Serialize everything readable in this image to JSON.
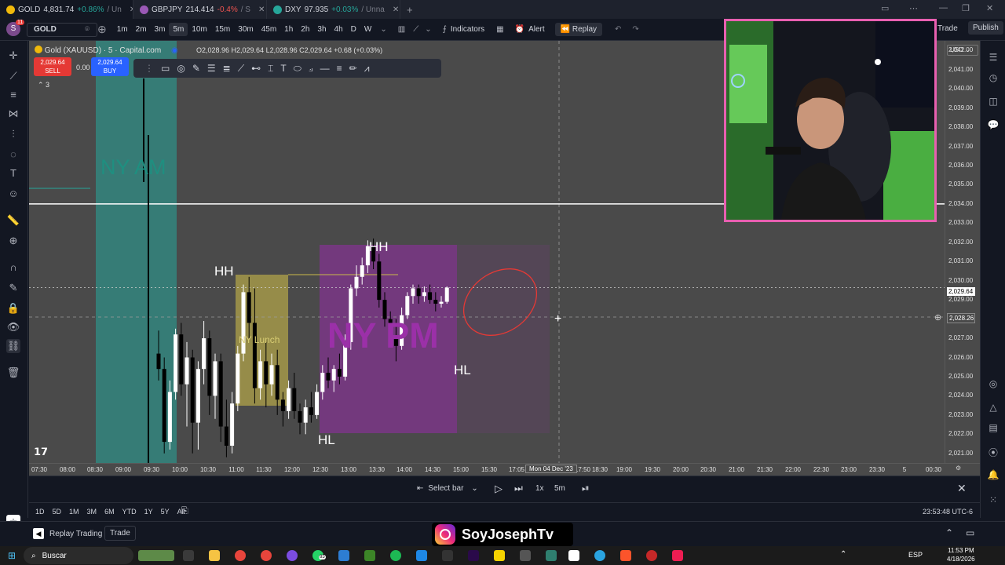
{
  "browser_tabs": [
    {
      "label": "GOLD",
      "price": "4,831.74",
      "change": "+0.86%",
      "suffix": "/ Un",
      "dir": "pos"
    },
    {
      "label": "GBPJPY",
      "price": "214.414",
      "change": "-0.4%",
      "suffix": "/ S",
      "dir": "neg"
    },
    {
      "label": "DXY",
      "price": "97.935",
      "change": "+0.03%",
      "suffix": "/ Unna",
      "dir": "pos"
    }
  ],
  "toolbar": {
    "avatar_badge": "11",
    "symbol": "GOLD",
    "timeframes": [
      "1m",
      "2m",
      "3m",
      "5m",
      "10m",
      "15m",
      "30m",
      "45m",
      "1h",
      "2h",
      "3h",
      "4h",
      "D",
      "W"
    ],
    "selected_timeframe": "5m",
    "indicators_label": "Indicators",
    "alert_label": "Alert",
    "replay_label": "Replay",
    "trade_label": "Trade",
    "publish_label": "Publish"
  },
  "legend": {
    "title": "Gold (XAUUSD) · 5 · Capital.com",
    "ohlc": "O2,028.96  H2,029.64  L2,028.96  C2,029.64  +0.68 (+0.03%)",
    "sell_price": "2,029.64",
    "sell_label": "SELL",
    "spread": "0.00",
    "buy_price": "2,029.64",
    "buy_label": "BUY",
    "collapsed_count": "3"
  },
  "chart_overlay_labels": {
    "ny_am": "NY AM",
    "ny_lunch": "NY Lunch",
    "ny_pm": "NY PM",
    "hh_left": "HH",
    "hh_right": "HH",
    "hl_bottom": "HL",
    "hl_right": "HL"
  },
  "price_axis": {
    "currency": "USD",
    "ticks": [
      "2,042.00",
      "2,041.00",
      "2,040.00",
      "2,039.00",
      "2,038.00",
      "2,037.00",
      "2,036.00",
      "2,035.00",
      "2,034.00",
      "2,033.00",
      "2,032.00",
      "2,031.00",
      "2,030.00",
      "2,029.00",
      "2,028.00",
      "2,027.00",
      "2,026.00",
      "2,025.00",
      "2,024.00",
      "2,023.00",
      "2,022.00",
      "2,021.00"
    ],
    "current_price": "2,029.64",
    "crosshair_price": "2,028.26"
  },
  "time_axis": {
    "ticks": [
      "07:30",
      "08:00",
      "08:30",
      "09:00",
      "09:30",
      "10:00",
      "10:30",
      "11:00",
      "11:30",
      "12:00",
      "12:30",
      "13:00",
      "13:30",
      "14:00",
      "14:30",
      "15:00",
      "15:30",
      "17:05",
      "17:50",
      "18:30",
      "19:00",
      "19:30",
      "20:00",
      "20:30",
      "21:00",
      "21:30",
      "22:00",
      "22:30",
      "23:00",
      "23:30",
      "5",
      "00:30"
    ],
    "cursor_date": "Mon 04 Dec '23"
  },
  "replay_bar": {
    "select_bar_label": "Select bar",
    "speed": "1x",
    "interval": "5m"
  },
  "range_bar": {
    "ranges": [
      "1D",
      "5D",
      "1M",
      "3M",
      "6M",
      "YTD",
      "1Y",
      "5Y",
      "All"
    ],
    "clock": "23:53:48 UTC-6"
  },
  "bottom_panel": {
    "replay_trading_label": "Replay Trading",
    "trade_label": "Trade",
    "instagram_handle": "SoyJosephTv"
  },
  "taskbar": {
    "search_label": "Buscar",
    "language": "ESP",
    "time": "11:53 PM",
    "date": "4/18/2026",
    "whatsapp_badge": "85"
  },
  "colors": {
    "ny_am_zone": "#26a69a",
    "ny_lunch_zone": "#c9b94a",
    "ny_pm_zone": "#9c27b0",
    "up_candle": "#ffffff",
    "down_candle": "#000000",
    "annotation_ellipse": "#e53935",
    "webcam_border": "#e85fb0"
  },
  "chart_data": {
    "type": "candlestick",
    "timeframe": "5m",
    "ylim": [
      2020.5,
      2042.5
    ],
    "key_level": 2034.0,
    "candles": [
      {
        "o": 2026.2,
        "h": 2027.4,
        "l": 2024.8,
        "c": 2025.4
      },
      {
        "o": 2025.4,
        "h": 2026.0,
        "l": 2021.0,
        "c": 2021.6
      },
      {
        "o": 2021.6,
        "h": 2024.8,
        "l": 2021.2,
        "c": 2024.2
      },
      {
        "o": 2024.2,
        "h": 2027.5,
        "l": 2023.8,
        "c": 2027.2
      },
      {
        "o": 2027.2,
        "h": 2027.8,
        "l": 2024.0,
        "c": 2024.6
      },
      {
        "o": 2024.6,
        "h": 2026.8,
        "l": 2022.4,
        "c": 2026.0
      },
      {
        "o": 2026.0,
        "h": 2026.4,
        "l": 2021.0,
        "c": 2022.6
      },
      {
        "o": 2022.6,
        "h": 2025.8,
        "l": 2021.2,
        "c": 2025.4
      },
      {
        "o": 2025.4,
        "h": 2027.9,
        "l": 2024.6,
        "c": 2027.0
      },
      {
        "o": 2027.0,
        "h": 2027.4,
        "l": 2023.0,
        "c": 2024.0
      },
      {
        "o": 2024.0,
        "h": 2026.2,
        "l": 2022.8,
        "c": 2025.8
      },
      {
        "o": 2025.8,
        "h": 2026.2,
        "l": 2021.6,
        "c": 2022.4
      },
      {
        "o": 2022.4,
        "h": 2023.8,
        "l": 2020.8,
        "c": 2021.4
      },
      {
        "o": 2021.4,
        "h": 2024.2,
        "l": 2021.0,
        "c": 2023.6
      },
      {
        "o": 2023.6,
        "h": 2026.6,
        "l": 2023.2,
        "c": 2026.2
      },
      {
        "o": 2026.2,
        "h": 2029.8,
        "l": 2025.8,
        "c": 2029.4
      },
      {
        "o": 2029.4,
        "h": 2030.2,
        "l": 2027.0,
        "c": 2027.8
      },
      {
        "o": 2027.8,
        "h": 2029.6,
        "l": 2023.6,
        "c": 2024.4
      },
      {
        "o": 2024.4,
        "h": 2026.4,
        "l": 2023.8,
        "c": 2025.8
      },
      {
        "o": 2025.8,
        "h": 2026.8,
        "l": 2023.4,
        "c": 2024.6
      },
      {
        "o": 2024.6,
        "h": 2026.2,
        "l": 2024.0,
        "c": 2025.6
      },
      {
        "o": 2025.6,
        "h": 2026.4,
        "l": 2023.0,
        "c": 2023.8
      },
      {
        "o": 2023.8,
        "h": 2024.2,
        "l": 2022.4,
        "c": 2023.2
      },
      {
        "o": 2023.2,
        "h": 2024.8,
        "l": 2022.8,
        "c": 2024.4
      },
      {
        "o": 2024.4,
        "h": 2025.2,
        "l": 2022.8,
        "c": 2023.2
      },
      {
        "o": 2023.2,
        "h": 2023.6,
        "l": 2022.0,
        "c": 2022.6
      },
      {
        "o": 2022.6,
        "h": 2023.8,
        "l": 2022.0,
        "c": 2023.4
      },
      {
        "o": 2023.4,
        "h": 2024.2,
        "l": 2022.6,
        "c": 2023.0
      },
      {
        "o": 2023.0,
        "h": 2024.6,
        "l": 2022.8,
        "c": 2024.2
      },
      {
        "o": 2024.2,
        "h": 2025.6,
        "l": 2023.8,
        "c": 2025.2
      },
      {
        "o": 2025.2,
        "h": 2026.0,
        "l": 2024.4,
        "c": 2024.8
      },
      {
        "o": 2024.8,
        "h": 2025.6,
        "l": 2024.2,
        "c": 2025.4
      },
      {
        "o": 2025.4,
        "h": 2026.2,
        "l": 2024.6,
        "c": 2025.0
      },
      {
        "o": 2025.0,
        "h": 2027.2,
        "l": 2024.8,
        "c": 2026.8
      },
      {
        "o": 2026.8,
        "h": 2029.8,
        "l": 2026.4,
        "c": 2029.6
      },
      {
        "o": 2029.6,
        "h": 2030.8,
        "l": 2029.2,
        "c": 2030.2
      },
      {
        "o": 2030.2,
        "h": 2031.2,
        "l": 2029.8,
        "c": 2030.8
      },
      {
        "o": 2030.8,
        "h": 2032.1,
        "l": 2030.4,
        "c": 2031.8
      },
      {
        "o": 2031.8,
        "h": 2032.2,
        "l": 2030.6,
        "c": 2031.0
      },
      {
        "o": 2031.0,
        "h": 2031.4,
        "l": 2028.6,
        "c": 2029.0
      },
      {
        "o": 2029.0,
        "h": 2029.4,
        "l": 2027.6,
        "c": 2028.0
      },
      {
        "o": 2028.0,
        "h": 2028.4,
        "l": 2026.6,
        "c": 2027.0
      },
      {
        "o": 2027.0,
        "h": 2028.0,
        "l": 2025.8,
        "c": 2026.6
      },
      {
        "o": 2026.6,
        "h": 2028.6,
        "l": 2026.4,
        "c": 2028.2
      },
      {
        "o": 2028.2,
        "h": 2029.4,
        "l": 2028.0,
        "c": 2029.2
      },
      {
        "o": 2029.2,
        "h": 2029.8,
        "l": 2028.8,
        "c": 2029.6
      },
      {
        "o": 2029.6,
        "h": 2029.8,
        "l": 2028.8,
        "c": 2029.2
      },
      {
        "o": 2029.2,
        "h": 2029.7,
        "l": 2028.9,
        "c": 2029.4
      },
      {
        "o": 2029.4,
        "h": 2029.8,
        "l": 2028.8,
        "c": 2029.0
      },
      {
        "o": 2029.0,
        "h": 2029.4,
        "l": 2028.4,
        "c": 2028.8
      },
      {
        "o": 2028.8,
        "h": 2029.2,
        "l": 2028.6,
        "c": 2028.9
      },
      {
        "o": 2028.9,
        "h": 2029.7,
        "l": 2028.8,
        "c": 2029.64
      }
    ]
  }
}
